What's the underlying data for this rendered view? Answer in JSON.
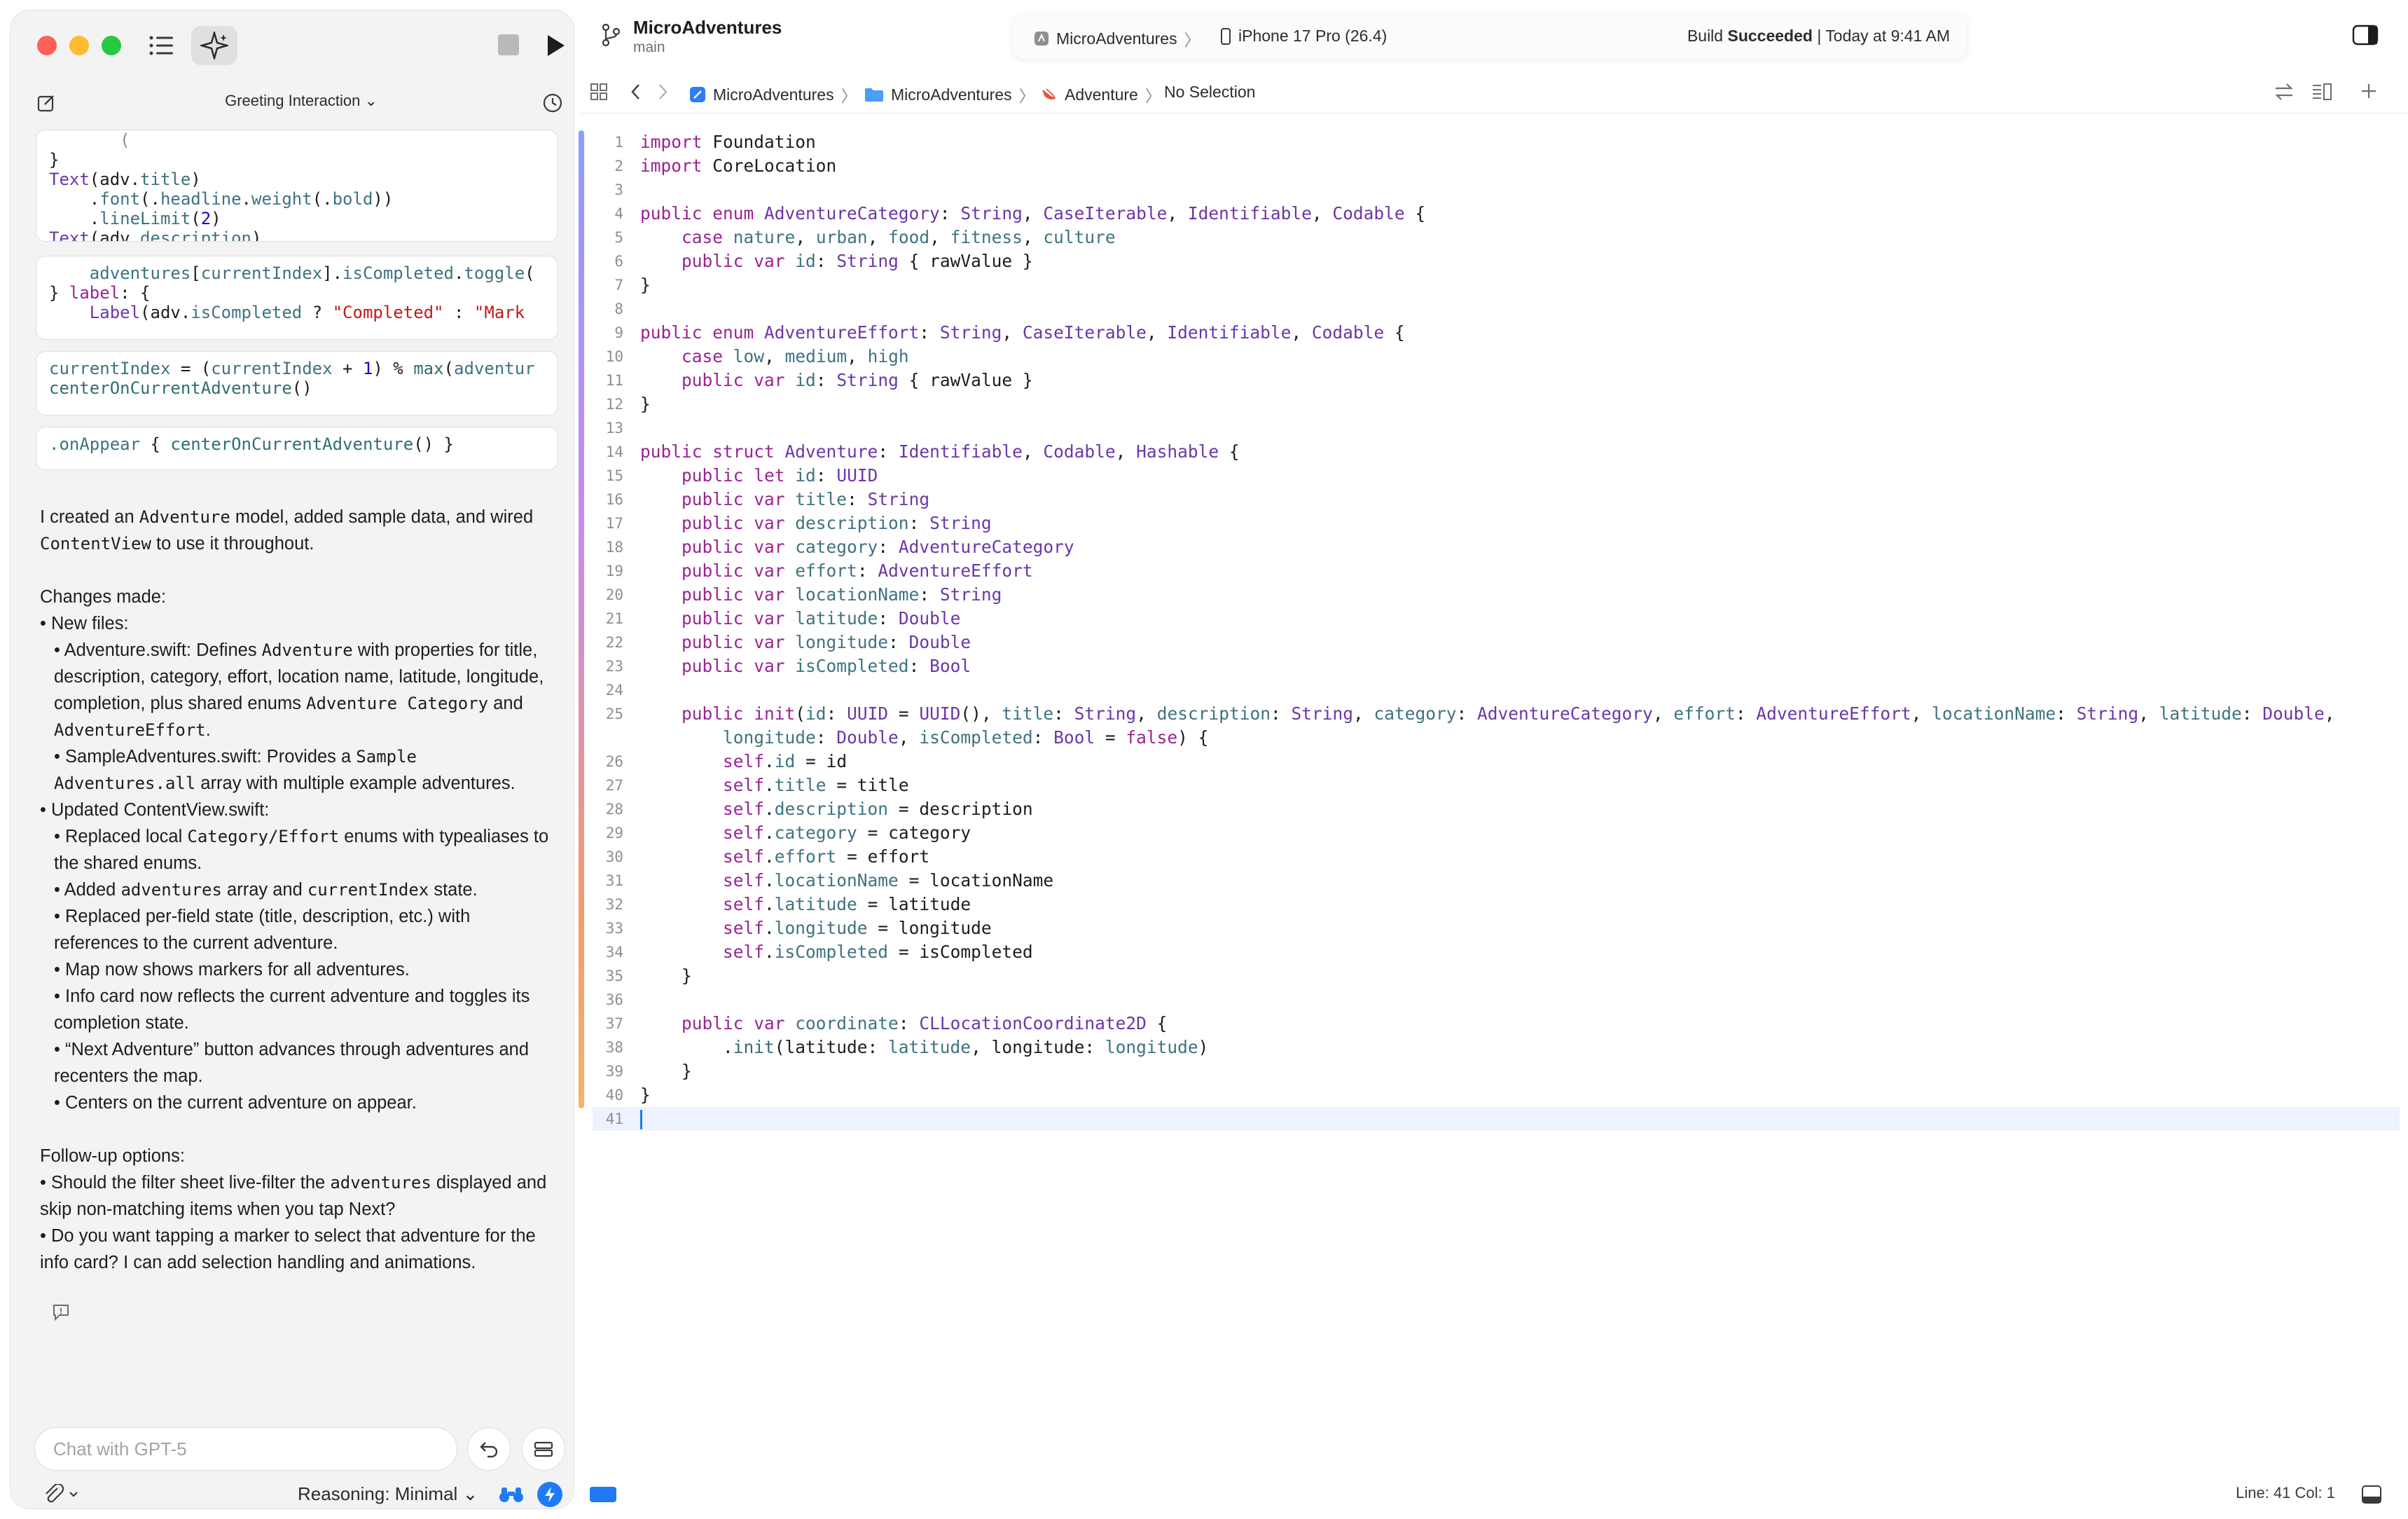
{
  "sidebar": {
    "conversation_title": "Greeting Interaction",
    "snippets": [
      [
        {
          "t": "Text(adv.title)"
        },
        {
          "t": "    .font(.headline.weight(.bold))"
        },
        {
          "t": "    .lineLimit(2)"
        },
        {
          "t": "Text(adv.description)"
        }
      ]
    ],
    "snippet1_prefix": "}",
    "snippet2": [
      "    adventures[currentIndex].isCompleted.toggle(",
      "} label: {",
      "    Label(adv.isCompleted ? \"Completed\" : \"Mark "
    ],
    "snippet3": [
      "currentIndex = (currentIndex + 1) % max(adventur",
      "centerOnCurrentAdventure()"
    ],
    "snippet4": ".onAppear { centerOnCurrentAdventure() }",
    "reply": {
      "intro_a": "I created an ",
      "intro_code1": "Adventure",
      "intro_b": " model, added sample data, and wired ",
      "intro_code2": "ContentView",
      "intro_c": " to use it throughout.",
      "changes_header": "Changes made:",
      "new_files": "• New files:",
      "adv_a": "• Adventure.swift: Defines ",
      "adv_code": "Adventure",
      "adv_b": " with properties for title, description, category, effort, location name, latitude, longitude, completion, plus shared enums ",
      "adv_code2": "Adventure Category",
      "adv_c": " and ",
      "adv_code3": "AdventureEffort",
      "adv_d": ".",
      "sample_a": "• SampleAdventures.swift: Provides a ",
      "sample_code": "Sample Adventures.all",
      "sample_b": " array with multiple example adventures.",
      "updated": "• Updated ContentView.swift:",
      "repl_a": "• Replaced local ",
      "repl_code": "Category/Effort",
      "repl_b": " enums with typealiases to the shared enums.",
      "added_a": "• Added ",
      "added_code1": "adventures",
      "added_b": " array and ",
      "added_code2": "currentIndex",
      "added_c": " state.",
      "perfield": "• Replaced per-field state (title, description, etc.) with references to the current adventure.",
      "map": "• Map now shows markers for all adventures.",
      "infocard": "• Info card now reflects the current adventure and toggles its completion state.",
      "next": "• “Next Adventure” button advances through adventures and recenters the map.",
      "centers": "• Centers on the current adventure on appear.",
      "followup_header": "Follow-up options:",
      "f1_a": "• Should the filter sheet live-filter the ",
      "f1_code": "adventures",
      "f1_b": " displayed and skip non-matching items when you tap Next?",
      "f2": "• Do you want tapping a marker to select that adventure for the info card? I can add selection handling and animations."
    },
    "chat_placeholder": "Chat with GPT-5",
    "reasoning_label": "Reasoning: Minimal"
  },
  "toolbar": {
    "project_name": "MicroAdventures",
    "branch": "main",
    "scheme": "MicroAdventures",
    "device": "iPhone 17 Pro (26.4)",
    "build_word": "Build ",
    "build_result": "Succeeded",
    "build_time": " | Today at 9:41 AM"
  },
  "jump_bar": {
    "project": "MicroAdventures",
    "folder": "MicroAdventures",
    "file": "Adventure",
    "selection": "No Selection"
  },
  "editor": {
    "cursor_position": "Line: 41  Col: 1"
  }
}
